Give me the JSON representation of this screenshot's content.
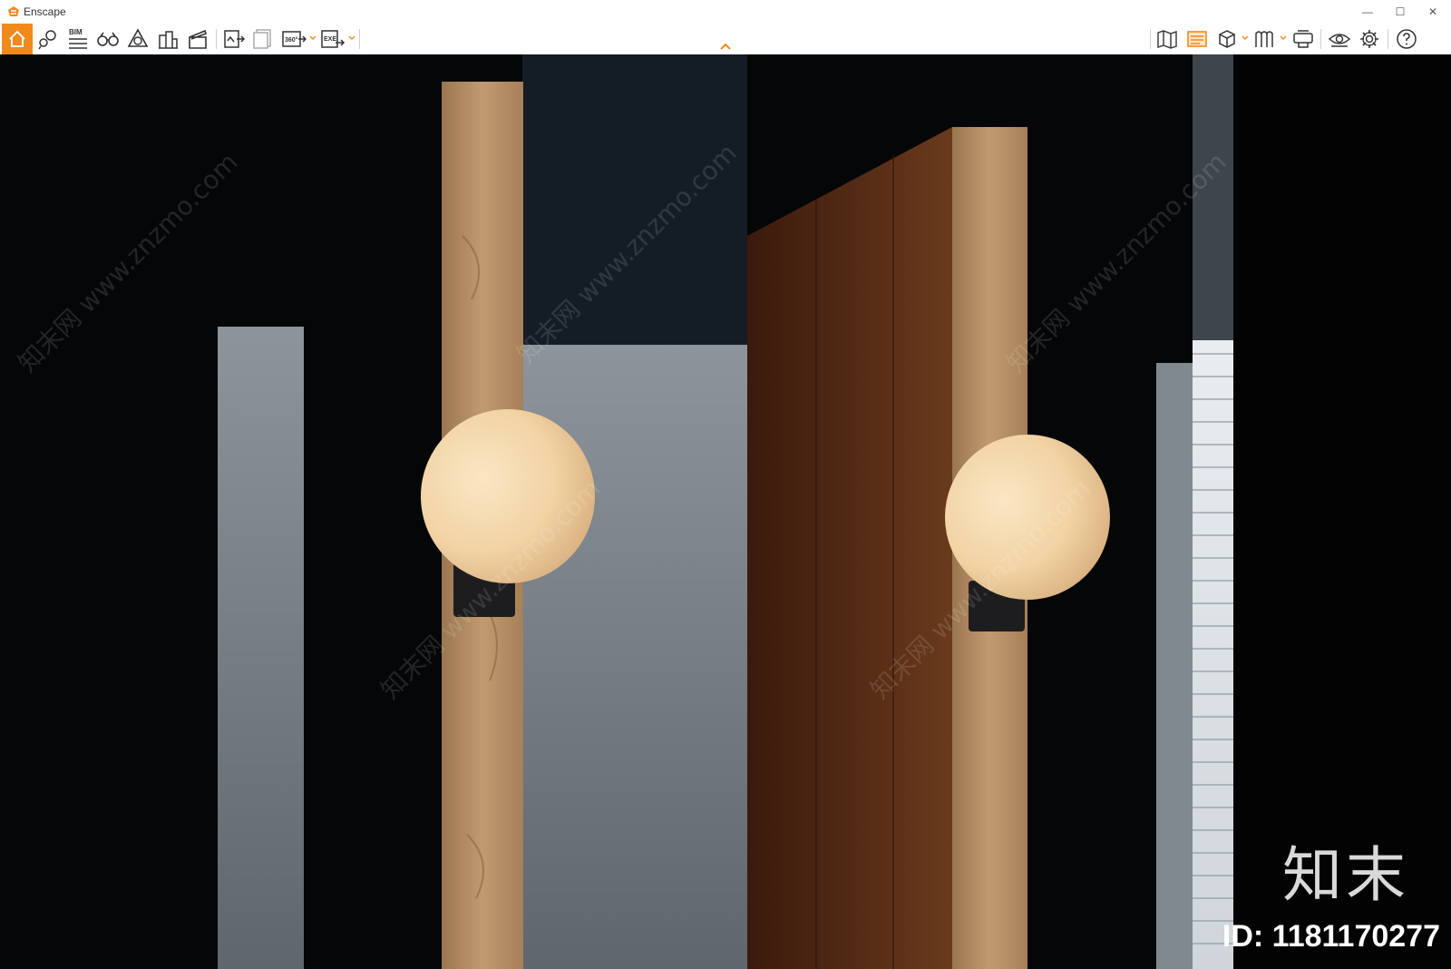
{
  "window": {
    "title": "Enscape",
    "controls": [
      {
        "name": "minimize-icon",
        "glyph": "—"
      },
      {
        "name": "maximize-icon",
        "glyph": "☐"
      },
      {
        "name": "close-icon",
        "glyph": "✕"
      }
    ]
  },
  "toolbar": {
    "bim_label": "BIM",
    "video360_label": "360°",
    "exe_label": "EXE",
    "accent_color": "#f08a1e",
    "left_tools": [
      "home-icon",
      "asset-library-icon",
      "bim-icon",
      "binoculars-icon",
      "atmosphere-icon",
      "buildings-icon",
      "video-editor-icon",
      "screenshot-export-icon",
      "batch-render-icon",
      "panorama-360-icon",
      "exe-export-icon"
    ],
    "right_tools": [
      "map-view-icon",
      "views-icon",
      "section-cube-icon",
      "sun-shadow-icon",
      "vr-headset-icon",
      "visual-settings-eye-icon",
      "settings-gear-icon",
      "help-icon"
    ]
  },
  "viewport": {
    "scene": "Render of two glowing globe wall sconces on wooden wall panels beside a window with blinds",
    "watermark_text": "知末网 www.znzmo.com",
    "brand_text": "知末",
    "id_text": "ID: 1181170277"
  }
}
